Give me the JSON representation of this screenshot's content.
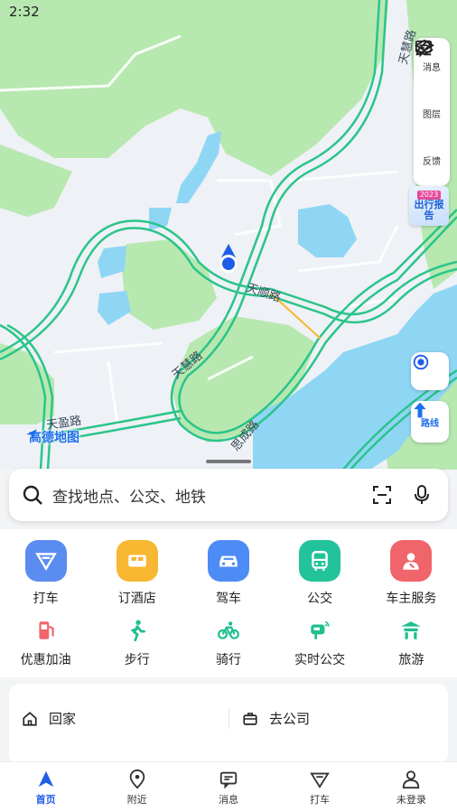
{
  "status_bar": {
    "time": "2:32"
  },
  "map": {
    "tools": [
      {
        "key": "messages",
        "label": "消息",
        "icon": "message-square-icon"
      },
      {
        "key": "layers",
        "label": "图层",
        "icon": "layers-icon"
      },
      {
        "key": "feedback",
        "label": "反馈",
        "icon": "edit-pencil-icon"
      }
    ],
    "report_badge": {
      "year": "2023",
      "title": "出行报告"
    },
    "route_button": {
      "label": "路线"
    },
    "logo_text": "高德地图",
    "road_labels": [
      "天顺路",
      "天慧路",
      "天盈路",
      "思成路",
      "天慧路"
    ]
  },
  "search": {
    "placeholder": "查找地点、公交、地铁"
  },
  "services": {
    "main": [
      {
        "label": "打车",
        "color": "#5b8cf0",
        "icon": "taxi-icon"
      },
      {
        "label": "订酒店",
        "color": "#f7b731",
        "icon": "bed-icon"
      },
      {
        "label": "驾车",
        "color": "#4e8cf5",
        "icon": "car-icon"
      },
      {
        "label": "公交",
        "color": "#22c39a",
        "icon": "bus-icon"
      },
      {
        "label": "车主服务",
        "color": "#f0646b",
        "icon": "car-owner-icon"
      }
    ],
    "secondary": [
      {
        "label": "优惠加油",
        "color": "#f0646b",
        "icon": "fuel-icon"
      },
      {
        "label": "步行",
        "color": "#1fbf8f",
        "icon": "walk-icon"
      },
      {
        "label": "骑行",
        "color": "#1fbf8f",
        "icon": "bike-icon"
      },
      {
        "label": "实时公交",
        "color": "#1fbf8f",
        "icon": "realtime-bus-icon"
      },
      {
        "label": "旅游",
        "color": "#1fbf8f",
        "icon": "travel-icon"
      }
    ]
  },
  "shortcuts": {
    "home": "回家",
    "work": "去公司"
  },
  "bottom_nav": [
    {
      "label": "首页",
      "active": true
    },
    {
      "label": "附近",
      "active": false
    },
    {
      "label": "消息",
      "active": false
    },
    {
      "label": "打车",
      "active": false
    },
    {
      "label": "未登录",
      "active": false
    }
  ],
  "colors": {
    "accent": "#1f5de6",
    "road": "#2bc48a",
    "water": "#8fd6f5",
    "green": "#b7e8b0"
  }
}
